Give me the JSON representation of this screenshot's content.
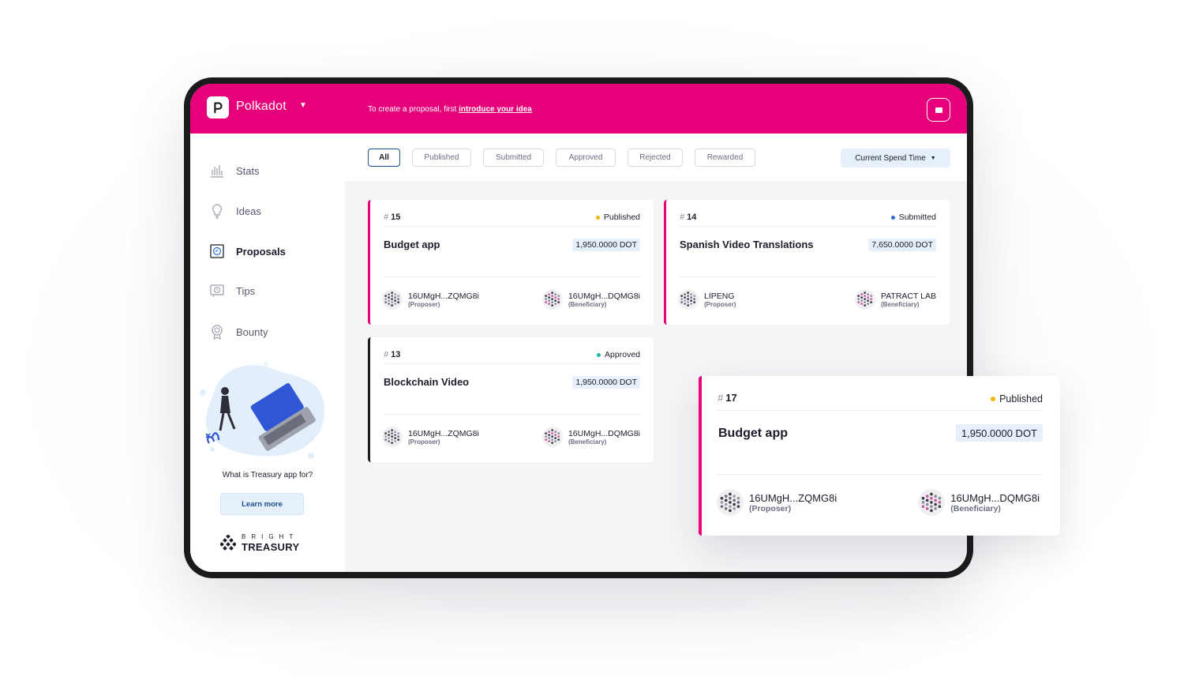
{
  "header": {
    "network": "Polkadot",
    "hint_prefix": "To create a proposal, first ",
    "hint_link": "introduce your idea"
  },
  "sidebar": {
    "items": [
      {
        "label": "Stats",
        "icon": "stats-icon"
      },
      {
        "label": "Ideas",
        "icon": "lightbulb-icon"
      },
      {
        "label": "Proposals",
        "icon": "proposals-icon",
        "active": true
      },
      {
        "label": "Tips",
        "icon": "tips-icon"
      },
      {
        "label": "Bounty",
        "icon": "bounty-icon"
      }
    ],
    "question": "What is Treasury app for?",
    "learn_more": "Learn more",
    "brand_top": "BRIGHT",
    "brand_bottom": "TREASURY"
  },
  "filters": {
    "tabs": [
      "All",
      "Published",
      "Submitted",
      "Approved",
      "Rejected",
      "Rewarded"
    ],
    "active": "All",
    "spend_select": "Current Spend Time"
  },
  "colors": {
    "accent": "#e6007a",
    "published": "#f5b400",
    "submitted": "#2f6fd1",
    "approved": "#22b8a8"
  },
  "proposals": [
    {
      "hash": "#",
      "number": "15",
      "status": "Published",
      "title": "Budget app",
      "amount": "1,950.0000 DOT",
      "proposer": "16UMgH...ZQMG8i",
      "proposer_role": "(Proposer)",
      "beneficiary": "16UMgH...DQMG8i",
      "beneficiary_role": "(Beneficiary)"
    },
    {
      "hash": "#",
      "number": "14",
      "status": "Submitted",
      "title": "Spanish Video Translations",
      "amount": "7,650.0000 DOT",
      "proposer": "LIPENG",
      "proposer_role": "(Proposer)",
      "beneficiary": "PATRACT LAB",
      "beneficiary_role": "(Beneficiary)"
    },
    {
      "hash": "#",
      "number": "13",
      "status": "Approved",
      "title": "Blockchain Video",
      "amount": "1,950.0000 DOT",
      "proposer": "16UMgH...ZQMG8i",
      "proposer_role": "(Proposer)",
      "beneficiary": "16UMgH...DQMG8i",
      "beneficiary_role": "(Beneficiary)"
    }
  ],
  "featured": {
    "hash": "#",
    "number": "17",
    "status": "Published",
    "title": "Budget app",
    "amount": "1,950.0000 DOT",
    "proposer": "16UMgH...ZQMG8i",
    "proposer_role": "(Proposer)",
    "beneficiary": "16UMgH...DQMG8i",
    "beneficiary_role": "(Beneficiary)"
  }
}
